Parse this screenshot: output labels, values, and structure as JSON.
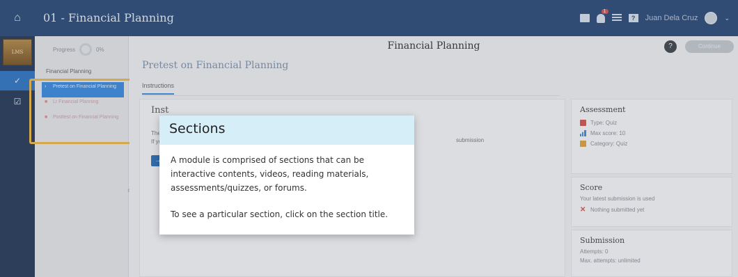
{
  "topbar": {
    "course_title": "01 - Financial Planning",
    "notification_count": "1",
    "username": "Juan Dela Cruz"
  },
  "rail": {
    "logo_text": "LMS"
  },
  "sections_panel": {
    "progress_label": "Progress",
    "progress_value": "0%",
    "module_label": "Financial Planning",
    "items": [
      {
        "label": "Pretest on Financial Planning",
        "active": true
      },
      {
        "label": "Lr Financial Planning",
        "active": false
      },
      {
        "label": "Posttest on Financial Planning",
        "active": false
      }
    ]
  },
  "main": {
    "header_title": "Financial Planning",
    "continue_label": "Continue",
    "section_title": "Pretest on Financial Planning",
    "tab_instructions": "Instructions",
    "card_heading": "Inst",
    "card_line1": "The",
    "card_line2": "If yo",
    "card_right_text": "submission"
  },
  "assessment": {
    "title": "Assessment",
    "type": "Type: Quiz",
    "max_score": "Max score: 10",
    "category": "Category: Quiz"
  },
  "score": {
    "title": "Score",
    "note": "Your latest submission is used",
    "status": "Nothing submitted yet"
  },
  "submission": {
    "title": "Submission",
    "attempts": "Attempts: 0",
    "max_attempts": "Max. attempts: unlimited"
  },
  "popup": {
    "title": "Sections",
    "paragraph1": "A module is comprised of sections that can be interactive contents, videos, reading materials, assessments/quizzes, or forums.",
    "paragraph2": "To see a particular section, click on the section title."
  },
  "colors": {
    "topbar": "#2a4a78",
    "active_blue": "#3c8be0",
    "highlight": "#f0b84a",
    "popup_header": "#d6eef7"
  }
}
